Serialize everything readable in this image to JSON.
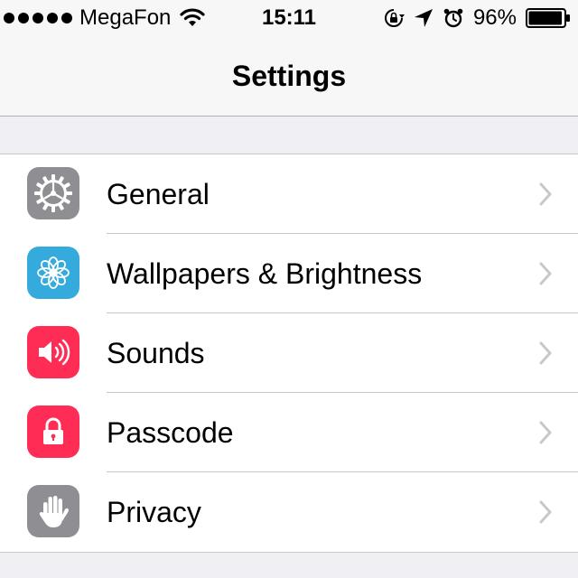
{
  "status_bar": {
    "carrier": "MegaFon",
    "time": "15:11",
    "battery_percent": "96%",
    "battery_level": 0.96,
    "signal_bars": 5,
    "icons": [
      "wifi-icon",
      "orientation-lock-icon",
      "location-arrow-icon",
      "alarm-icon",
      "battery-icon"
    ]
  },
  "nav": {
    "title": "Settings"
  },
  "settings": {
    "items": [
      {
        "label": "General",
        "icon": "gear-icon",
        "color": "#8e8e93"
      },
      {
        "label": "Wallpapers & Brightness",
        "icon": "flower-icon",
        "color": "#35aadc"
      },
      {
        "label": "Sounds",
        "icon": "speaker-icon",
        "color": "#ff2d55"
      },
      {
        "label": "Passcode",
        "icon": "lock-icon",
        "color": "#ff2d55"
      },
      {
        "label": "Privacy",
        "icon": "hand-icon",
        "color": "#8e8e93"
      }
    ]
  },
  "colors": {
    "chevron": "#c7c7cc",
    "separator": "#c8c7cc",
    "background": "#efeff4"
  }
}
